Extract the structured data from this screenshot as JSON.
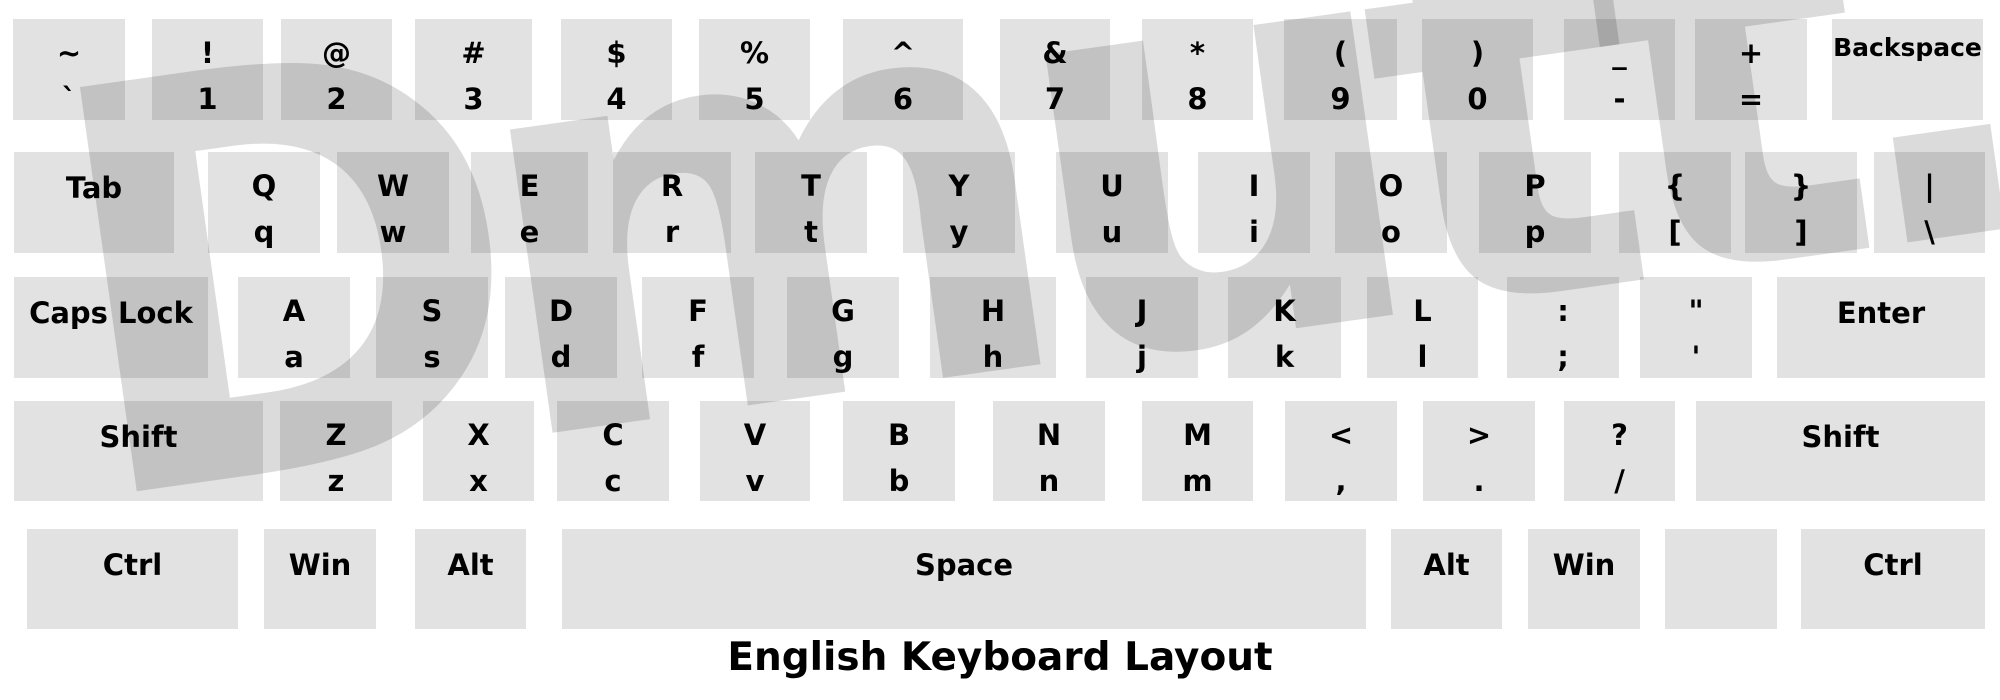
{
  "title": "English Keyboard Layout",
  "watermark": "Dmutt.in",
  "colors": {
    "key_bg": "#e2e2e2",
    "text": "#000000",
    "background": "#ffffff"
  },
  "rows": [
    [
      {
        "top": "~",
        "bot": "`"
      },
      {
        "top": "!",
        "bot": "1"
      },
      {
        "top": "@",
        "bot": "2"
      },
      {
        "top": "#",
        "bot": "3"
      },
      {
        "top": "$",
        "bot": "4"
      },
      {
        "top": "%",
        "bot": "5"
      },
      {
        "top": "^",
        "bot": "6"
      },
      {
        "top": "&",
        "bot": "7"
      },
      {
        "top": "*",
        "bot": "8"
      },
      {
        "top": "(",
        "bot": "9"
      },
      {
        "top": ")",
        "bot": "0"
      },
      {
        "top": "_",
        "bot": "-"
      },
      {
        "top": "+",
        "bot": "="
      },
      {
        "label": "Backspace"
      }
    ],
    [
      {
        "label": "Tab"
      },
      {
        "top": "Q",
        "bot": "q"
      },
      {
        "top": "W",
        "bot": "w"
      },
      {
        "top": "E",
        "bot": "e"
      },
      {
        "top": "R",
        "bot": "r"
      },
      {
        "top": "T",
        "bot": "t"
      },
      {
        "top": "Y",
        "bot": "y"
      },
      {
        "top": "U",
        "bot": "u"
      },
      {
        "top": "I",
        "bot": "i"
      },
      {
        "top": "O",
        "bot": "o"
      },
      {
        "top": "P",
        "bot": "p"
      },
      {
        "top": "{",
        "bot": "["
      },
      {
        "top": "}",
        "bot": "]"
      },
      {
        "top": "|",
        "bot": "\\"
      }
    ],
    [
      {
        "label": "Caps Lock"
      },
      {
        "top": "A",
        "bot": "a"
      },
      {
        "top": "S",
        "bot": "s"
      },
      {
        "top": "D",
        "bot": "d"
      },
      {
        "top": "F",
        "bot": "f"
      },
      {
        "top": "G",
        "bot": "g"
      },
      {
        "top": "H",
        "bot": "h"
      },
      {
        "top": "J",
        "bot": "j"
      },
      {
        "top": "K",
        "bot": "k"
      },
      {
        "top": "L",
        "bot": "l"
      },
      {
        "top": ":",
        "bot": ";"
      },
      {
        "top": "\"",
        "bot": "'"
      },
      {
        "label": "Enter"
      }
    ],
    [
      {
        "label": "Shift"
      },
      {
        "top": "Z",
        "bot": "z"
      },
      {
        "top": "X",
        "bot": "x"
      },
      {
        "top": "C",
        "bot": "c"
      },
      {
        "top": "V",
        "bot": "v"
      },
      {
        "top": "B",
        "bot": "b"
      },
      {
        "top": "N",
        "bot": "n"
      },
      {
        "top": "M",
        "bot": "m"
      },
      {
        "top": "<",
        "bot": ","
      },
      {
        "top": ">",
        "bot": "."
      },
      {
        "top": "?",
        "bot": "/"
      },
      {
        "label": "Shift"
      }
    ],
    [
      {
        "label": "Ctrl"
      },
      {
        "label": "Win"
      },
      {
        "label": "Alt"
      },
      {
        "label": "Space"
      },
      {
        "label": "Alt"
      },
      {
        "label": "Win"
      },
      {
        "label": ""
      },
      {
        "label": "Ctrl"
      }
    ]
  ]
}
